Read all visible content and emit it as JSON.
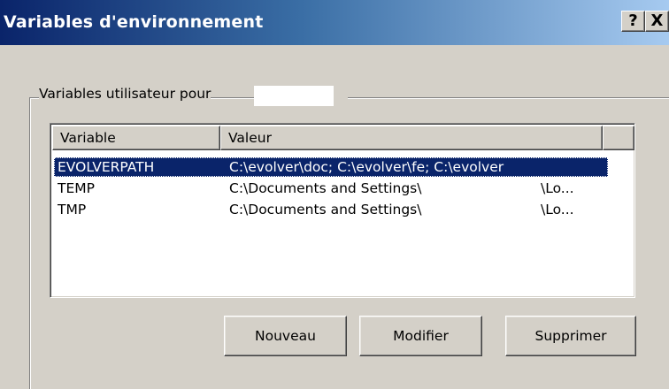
{
  "window": {
    "title": "Variables d'environnement",
    "help_label": "?",
    "close_label": "X"
  },
  "group": {
    "label": "Variables utilisateur pour"
  },
  "list": {
    "columns": [
      "Variable",
      "Valeur"
    ],
    "rows": [
      {
        "variable": "EVOLVERPATH",
        "value": "C:\\evolver\\doc; C:\\evolver\\fe; C:\\evolver",
        "tail": ""
      },
      {
        "variable": "TEMP",
        "value": "C:\\Documents and Settings\\",
        "tail": "\\Lo..."
      },
      {
        "variable": "TMP",
        "value": "C:\\Documents and Settings\\",
        "tail": "\\Lo..."
      }
    ],
    "selected_row": 0
  },
  "buttons": {
    "new": "Nouveau",
    "edit": "Modifier",
    "delete": "Supprimer"
  },
  "colors": {
    "title_gradient_start": "#0a246a",
    "title_gradient_end": "#a6caf0",
    "selection": "#0a246a",
    "face": "#d4d0c8"
  }
}
